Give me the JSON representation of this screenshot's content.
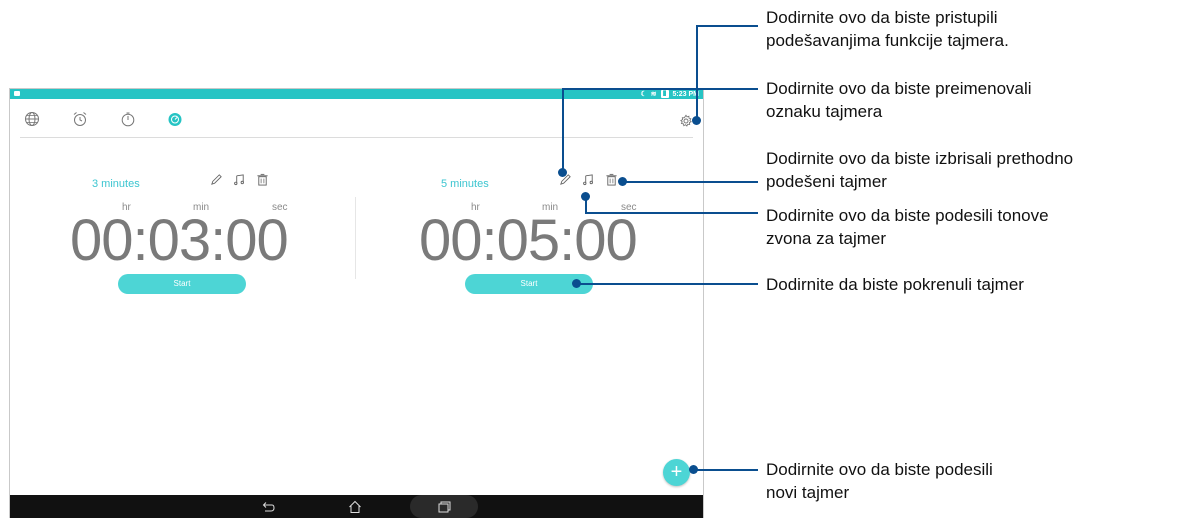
{
  "status_bar": {
    "time": "5:23 PM"
  },
  "tabs": [
    {
      "name": "world-clock",
      "icon": "globe-icon"
    },
    {
      "name": "alarm",
      "icon": "alarm-clock-icon"
    },
    {
      "name": "stopwatch",
      "icon": "stopwatch-icon"
    },
    {
      "name": "timer",
      "icon": "timer-icon",
      "active": true
    }
  ],
  "timers": [
    {
      "label": "3 minutes",
      "units": {
        "hr": "hr",
        "min": "min",
        "sec": "sec"
      },
      "time": "00:03:00",
      "start_label": "Start"
    },
    {
      "label": "5 minutes",
      "units": {
        "hr": "hr",
        "min": "min",
        "sec": "sec"
      },
      "time": "00:05:00",
      "start_label": "Start"
    }
  ],
  "fab_label": "+",
  "callouts": [
    {
      "text_1": "Dodirnite ovo da biste pristupili",
      "text_2": "podešavanjima funkcije tajmera."
    },
    {
      "text_1": "Dodirnite ovo da biste preimenovali",
      "text_2": "oznaku tajmera"
    },
    {
      "text_1": "Dodirnite ovo da biste izbrisali prethodno",
      "text_2": "podešeni tajmer"
    },
    {
      "text_1": "Dodirnite ovo da biste podesili tonove",
      "text_2": "zvona za tajmer"
    },
    {
      "text_1": "Dodirnite da biste pokrenuli tajmer",
      "text_2": ""
    },
    {
      "text_1": "Dodirnite ovo da biste podesili",
      "text_2": "novi tajmer"
    }
  ],
  "colors": {
    "accent": "#26c4c4",
    "button": "#4dd5d5",
    "callout": "#0a4e8f"
  }
}
